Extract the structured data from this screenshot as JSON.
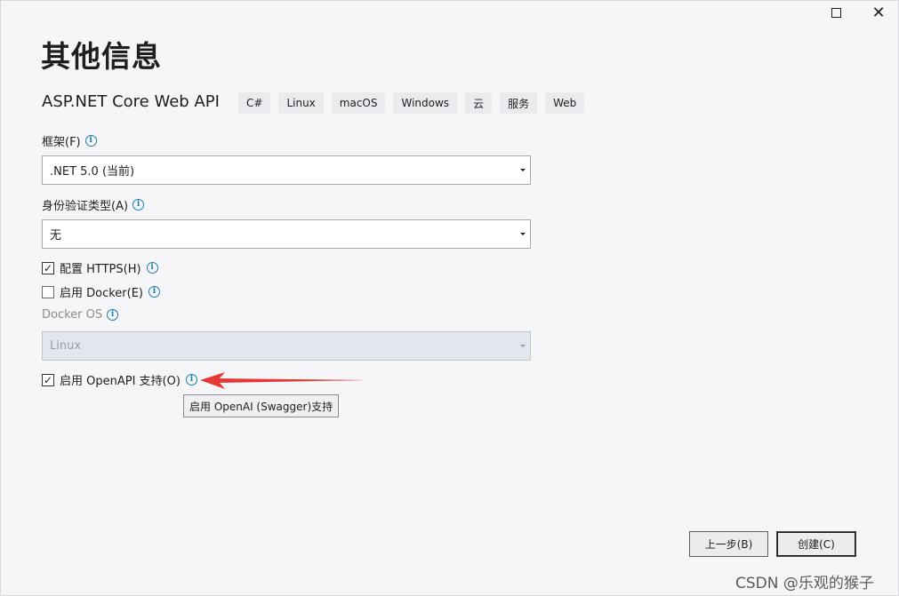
{
  "window": {
    "maximize_icon": "maximize-icon",
    "close_glyph": "✕"
  },
  "header": {
    "title": "其他信息",
    "project_name": "ASP.NET Core Web API",
    "tags": [
      "C#",
      "Linux",
      "macOS",
      "Windows",
      "云",
      "服务",
      "Web"
    ]
  },
  "form": {
    "framework": {
      "label": "框架(F)",
      "value": ".NET 5.0 (当前)"
    },
    "auth": {
      "label": "身份验证类型(A)",
      "value": "无"
    },
    "https": {
      "label": "配置 HTTPS(H)",
      "checked": true
    },
    "docker": {
      "label": "启用 Docker(E)",
      "checked": false
    },
    "docker_os": {
      "label": "Docker OS",
      "value": "Linux",
      "disabled": true
    },
    "openapi": {
      "label": "启用 OpenAPI 支持(O)",
      "checked": true
    },
    "check_glyph": "✓",
    "info_glyph": "i"
  },
  "tooltip": {
    "text": "启用 OpenAI (Swagger)支持"
  },
  "footer": {
    "back_label": "上一步(B)",
    "create_label": "创建(C)"
  },
  "watermark": "CSDN @乐观的猴子",
  "colors": {
    "info": "#1a7db0",
    "annotation_arrow": "#e53935"
  }
}
